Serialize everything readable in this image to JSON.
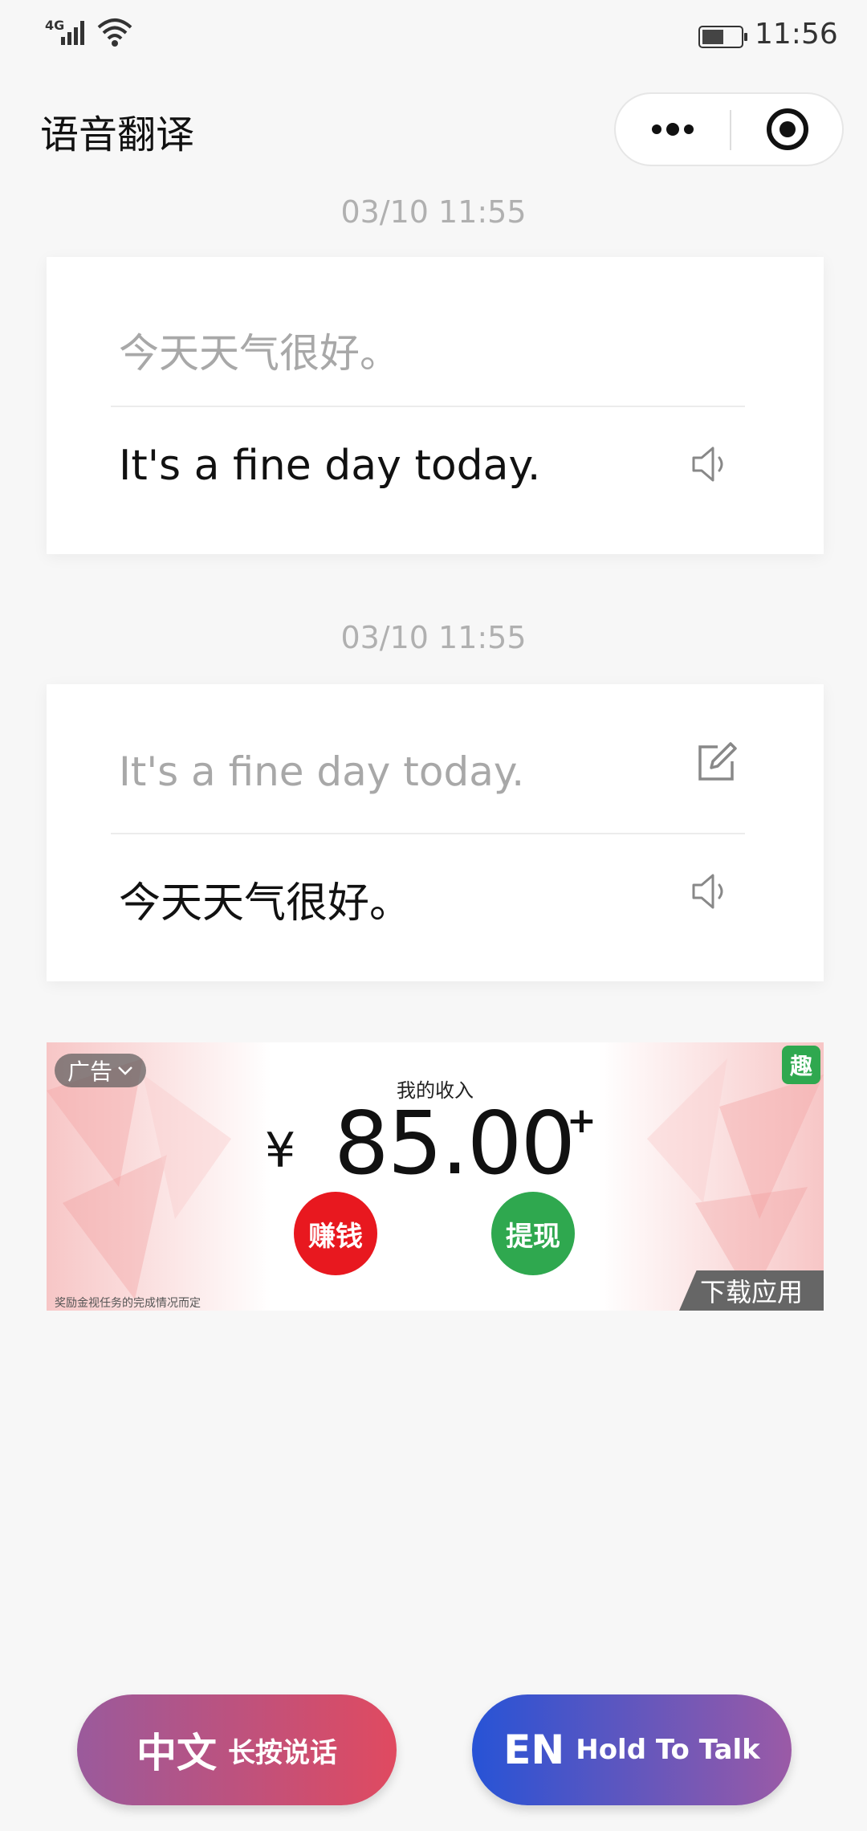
{
  "status_bar": {
    "network": "4G",
    "time": "11:56"
  },
  "header": {
    "title": "语音翻译",
    "more_icon": "more-dots-icon",
    "close_icon": "target-close-icon"
  },
  "conversations": [
    {
      "timestamp": "03/10 11:55",
      "source_text": "今天天气很好。",
      "translated_text": "It's a fine day today."
    },
    {
      "timestamp": "03/10 11:55",
      "source_text": "It's a fine day today.",
      "translated_text": "今天天气很好。"
    }
  ],
  "ad": {
    "badge_label": "广告",
    "corner_icon_label": "趣",
    "income_label": "我的收入",
    "currency": "¥",
    "amount": "85.00",
    "plus": "+",
    "earn_label": "赚钱",
    "withdraw_label": "提现",
    "footnote": "奖励金视任务的完成情况而定",
    "download_label": "下载应用"
  },
  "talk_buttons": {
    "zh": {
      "lang": "中文",
      "hint": "长按说话"
    },
    "en": {
      "lang": "EN",
      "hint": "Hold To Talk"
    }
  },
  "colors": {
    "zh_gradient_start": "#9a5a9c",
    "zh_gradient_end": "#e04a60",
    "en_gradient_start": "#2753d6",
    "en_gradient_end": "#9b5aa6",
    "earn_red": "#e8181f",
    "withdraw_green": "#2fa84f"
  }
}
